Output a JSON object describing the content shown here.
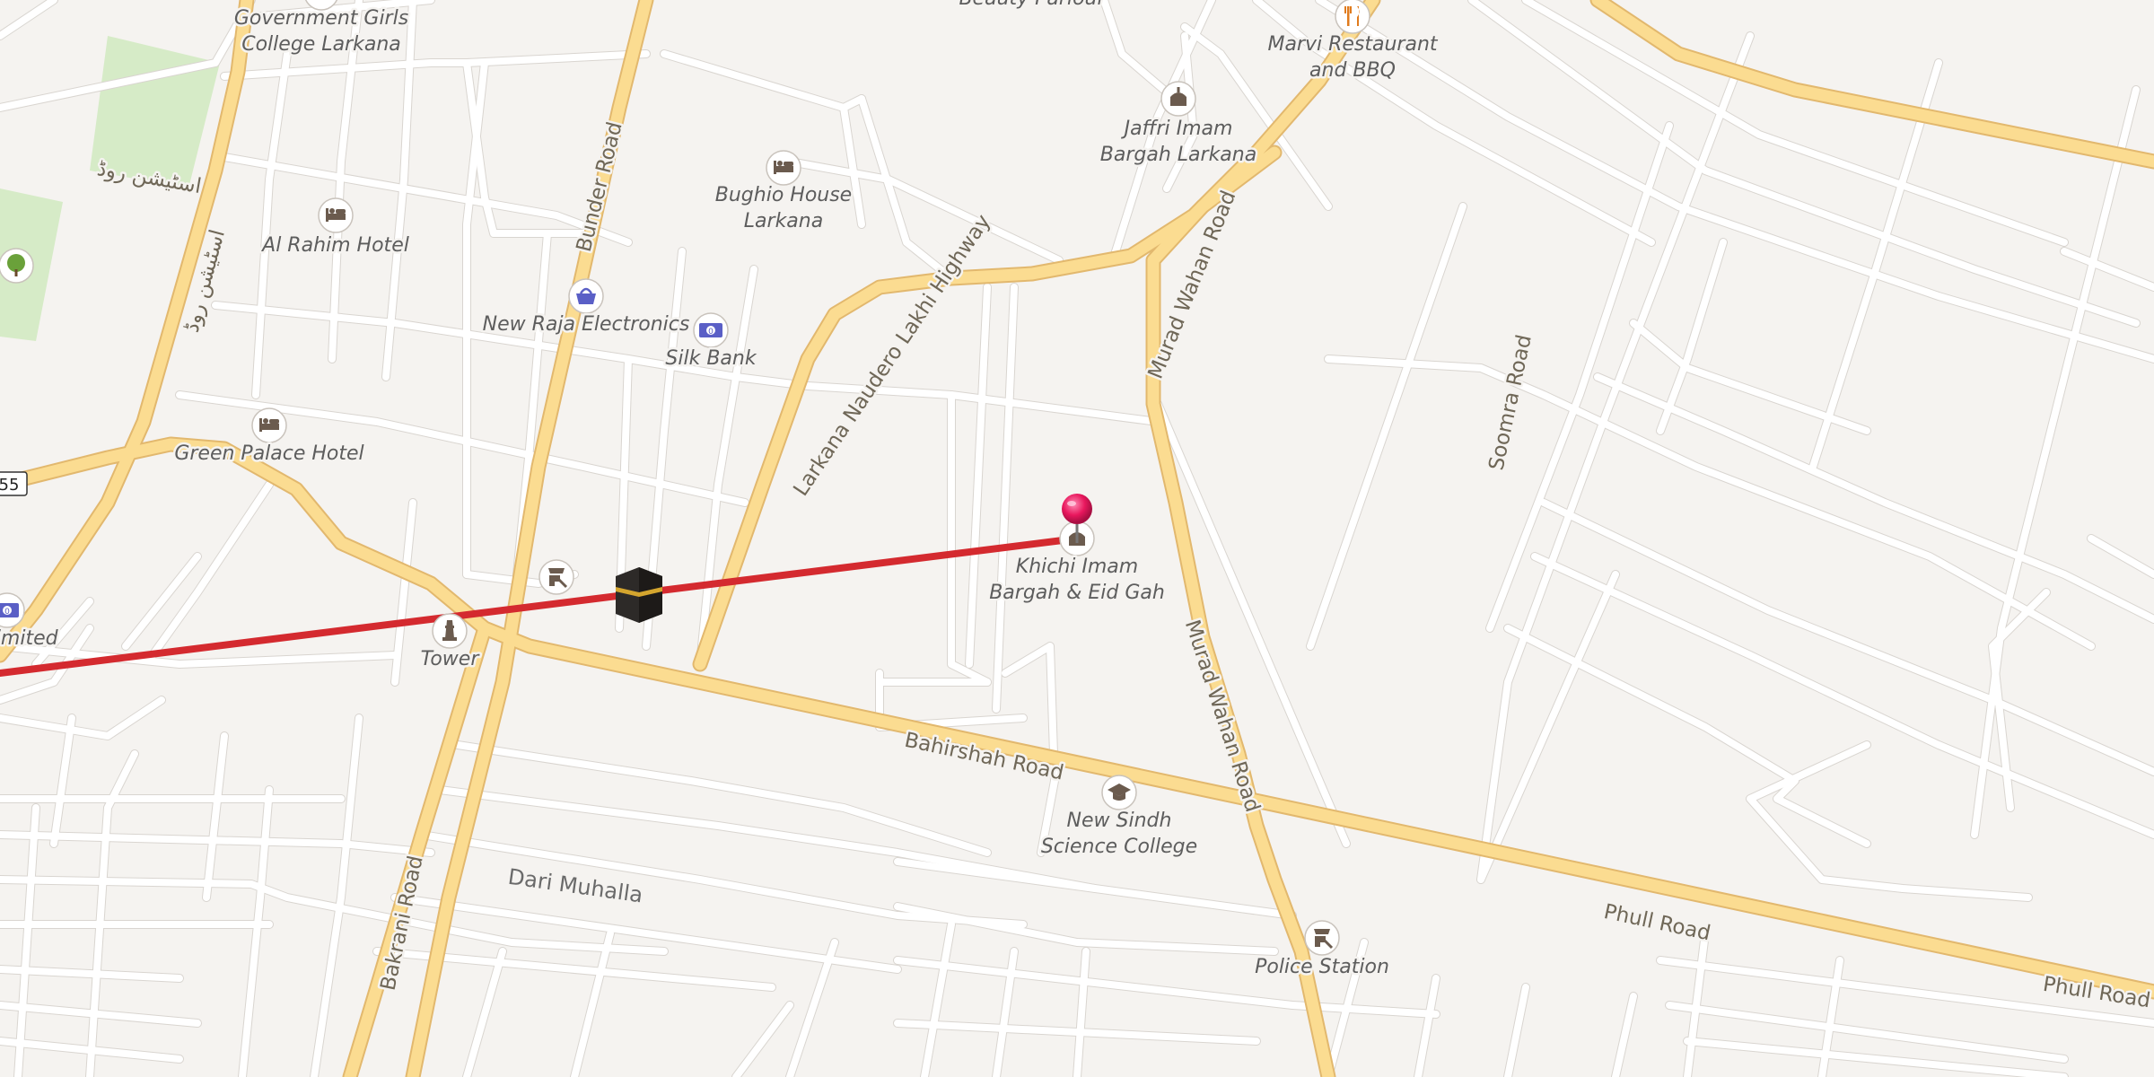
{
  "map": {
    "area_label": "Dari Muhalla",
    "route_number": "55",
    "roads": [
      {
        "id": "bunder",
        "label": "Bunder Road"
      },
      {
        "id": "lakhi",
        "label": "Larkana Naudero Lakhi Highway"
      },
      {
        "id": "murad1",
        "label": "Murad Wahan Road"
      },
      {
        "id": "murad2",
        "label": "Murad Wahan Road"
      },
      {
        "id": "soomra",
        "label": "Soomra Road"
      },
      {
        "id": "bahirshah",
        "label": "Bahirshah Road"
      },
      {
        "id": "phull1",
        "label": "Phull Road"
      },
      {
        "id": "phull2",
        "label": "Phull Road"
      },
      {
        "id": "bakrani",
        "label": "Bakrani Road"
      },
      {
        "id": "urdu1",
        "label": "اسٹیشن روڈ"
      },
      {
        "id": "urdu2",
        "label": "اسٹیشن روڈ"
      }
    ],
    "pois": [
      {
        "id": "govt-girls",
        "icon": "school-icon",
        "lines": [
          "Government Girls",
          "College Larkana"
        ]
      },
      {
        "id": "beauty",
        "icon": "shop-icon",
        "lines": [
          "Beauty Parlour"
        ]
      },
      {
        "id": "marvi",
        "icon": "restaurant-icon",
        "lines": [
          "Marvi Restaurant",
          "and BBQ"
        ]
      },
      {
        "id": "jaffri",
        "icon": "mosque-icon",
        "lines": [
          "Jaffri Imam",
          "Bargah Larkana"
        ]
      },
      {
        "id": "bughio",
        "icon": "hotel-icon",
        "lines": [
          "Bughio House",
          "Larkana"
        ]
      },
      {
        "id": "al-rahim",
        "icon": "hotel-icon",
        "lines": [
          "Al Rahim Hotel"
        ]
      },
      {
        "id": "new-raja",
        "icon": "shopping-basket-icon",
        "lines": [
          "New Raja Electronics"
        ]
      },
      {
        "id": "silk-bank",
        "icon": "bank-icon",
        "lines": [
          "Silk Bank"
        ]
      },
      {
        "id": "green-palace",
        "icon": "hotel-icon",
        "lines": [
          "Green Palace Hotel"
        ]
      },
      {
        "id": "khichi",
        "icon": "mosque-icon",
        "lines": [
          "Khichi Imam",
          "Bargah & Eid Gah"
        ]
      },
      {
        "id": "bank-limited",
        "icon": "bank-icon",
        "lines": [
          "ank Limited"
        ]
      },
      {
        "id": "tower",
        "icon": "tower-icon",
        "lines": [
          "Tower"
        ]
      },
      {
        "id": "new-sindh",
        "icon": "graduation-cap-icon",
        "lines": [
          "New Sindh",
          "Science College"
        ]
      },
      {
        "id": "police",
        "icon": "police-icon",
        "lines": [
          "Police Station"
        ]
      },
      {
        "id": "police-2",
        "icon": "police-icon",
        "lines": []
      },
      {
        "id": "park-tree",
        "icon": "tree-icon",
        "lines": []
      }
    ],
    "route": {
      "color": "#d42a2f",
      "description": "Qibla direction line"
    },
    "markers": [
      {
        "id": "kaaba",
        "icon": "kaaba-icon"
      },
      {
        "id": "location-pin",
        "icon": "map-pin-icon",
        "color": "#e8175d"
      }
    ],
    "colors": {
      "background": "#f5f3f0",
      "minor_road": "#ffffff",
      "major_road": "#fbdc91",
      "park": "#d6ebc7",
      "icon_fill": "#6b5b4e",
      "icon_ring": "#ffffff"
    }
  }
}
